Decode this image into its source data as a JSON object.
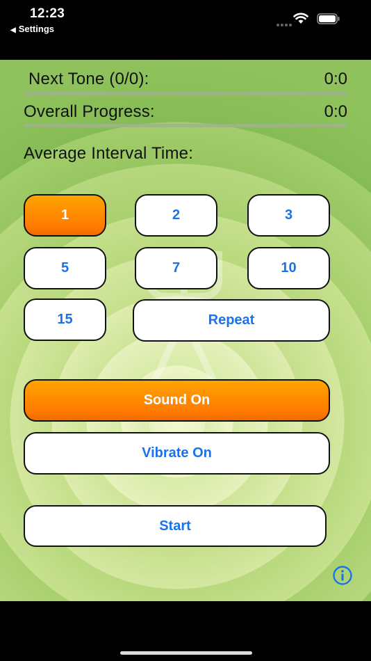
{
  "status_bar": {
    "time": "12:23",
    "back_label": "Settings",
    "back_icon": "back-arrow-icon"
  },
  "progress": {
    "next_tone_label": "Next Tone (0/0):",
    "next_tone_value": "0:0",
    "next_tone_fraction": 0,
    "overall_label": "Overall Progress:",
    "overall_value": "0:0",
    "overall_fraction": 0
  },
  "interval": {
    "label": "Average Interval Time:",
    "options": [
      "1",
      "2",
      "3",
      "5",
      "7",
      "10",
      "15"
    ],
    "selected": "1",
    "repeat_label": "Repeat"
  },
  "controls": {
    "sound_label": "Sound On",
    "sound_on": true,
    "vibrate_label": "Vibrate On",
    "vibrate_on": false,
    "start_label": "Start"
  },
  "colors": {
    "accent_orange": "#ff8a00",
    "button_text_blue": "#1a73e8",
    "background_green": "#a9d06e"
  },
  "icons": {
    "info": "info-icon",
    "wifi": "wifi-icon",
    "battery": "battery-icon"
  }
}
